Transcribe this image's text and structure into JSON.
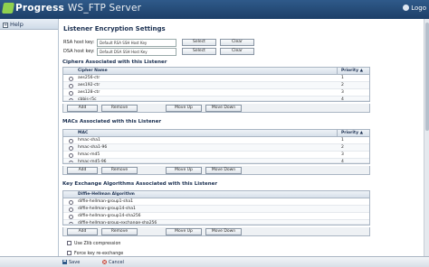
{
  "app": {
    "logo_brand": "Progress",
    "logo_product": "WS_FTP Server",
    "user": "Logo"
  },
  "sidebar": {
    "help_label": "Help"
  },
  "page": {
    "title": "Listener Encryption Settings"
  },
  "keys": {
    "rsa_label": "RSA host key:",
    "rsa_value": "Default RSA SSH Host Key",
    "dsa_label": "DSA host key:",
    "dsa_value": "Default DSA SSH Host Key",
    "select_label": "Select",
    "clear_label": "Clear"
  },
  "ciphers": {
    "section_title": "Ciphers Associated with this Listener",
    "col_name": "Cipher Name",
    "col_priority": "Priority ▲",
    "rows": [
      {
        "name": "aes256-ctr",
        "priority": "1"
      },
      {
        "name": "aes192-ctr",
        "priority": "2"
      },
      {
        "name": "aes128-ctr",
        "priority": "3"
      },
      {
        "name": "cbbis-r5c",
        "priority": "4"
      }
    ],
    "add_label": "Add",
    "remove_label": "Remove",
    "move_up_label": "Move Up",
    "move_down_label": "Move Down"
  },
  "macs": {
    "section_title": "MACs Associated with this Listener",
    "col_name": "MAC",
    "col_priority": "Priority ▲",
    "rows": [
      {
        "name": "hmac-sha1",
        "priority": "1"
      },
      {
        "name": "hmac-sha1-96",
        "priority": "2"
      },
      {
        "name": "hmac-md5",
        "priority": "3"
      },
      {
        "name": "hmac-md5-96",
        "priority": "4"
      }
    ],
    "add_label": "Add",
    "remove_label": "Remove",
    "move_up_label": "Move Up",
    "move_down_label": "Move Down"
  },
  "kex": {
    "section_title": "Key Exchange Algorithms Associated with this Listener",
    "col_name": "Diffie-Hellman Algorithm",
    "rows": [
      {
        "name": "diffie-hellman-group1-sha1"
      },
      {
        "name": "diffie-hellman-group14-sha1"
      },
      {
        "name": "diffie-hellman-group14-sha256"
      },
      {
        "name": "diffie-hellman-group-exchange-sha256"
      }
    ],
    "add_label": "Add",
    "remove_label": "Remove",
    "move_up_label": "Move Up",
    "move_down_label": "Move Down"
  },
  "options": {
    "zlib_label": "Use Zlib compression",
    "rekey_label": "Force key re-exchange"
  },
  "footer": {
    "save_label": "Save",
    "cancel_label": "Cancel"
  }
}
